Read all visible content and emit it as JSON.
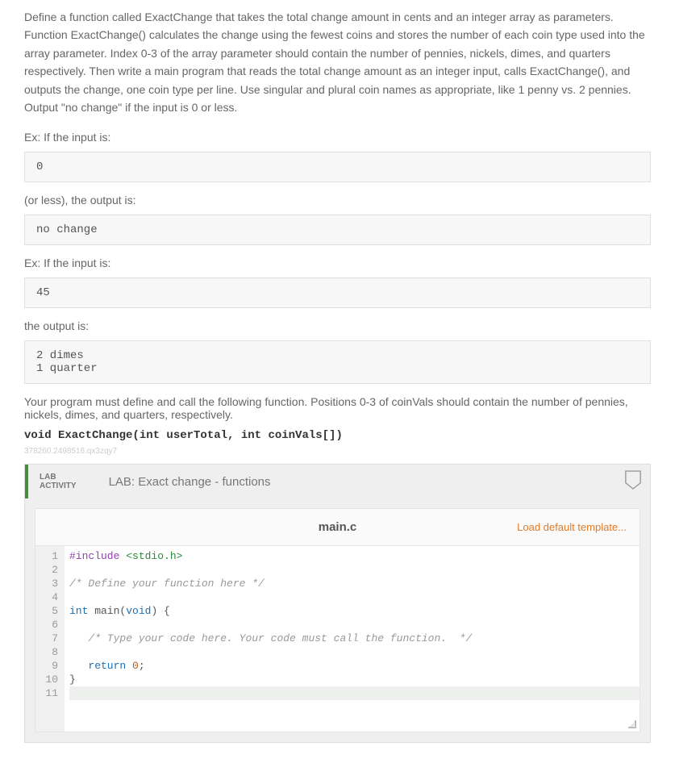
{
  "description": "Define a function called ExactChange that takes the total change amount in cents and an integer array as parameters. Function ExactChange() calculates the change using the fewest coins and stores the number of each coin type used into the array parameter. Index 0-3 of the array parameter should contain the number of pennies, nickels, dimes, and quarters respectively. Then write a main program that reads the total change amount as an integer input, calls ExactChange(), and outputs the change, one coin type per line. Use singular and plural coin names as appropriate, like 1 penny vs. 2 pennies. Output \"no change\" if the input is 0 or less.",
  "example1_label": "Ex: If the input is:",
  "example1_input": "0",
  "example1_or_less": "(or less), the output is:",
  "example1_output": "no change",
  "example2_label": "Ex: If the input is:",
  "example2_input": "45",
  "example2_output_label": "the output is:",
  "example2_output": "2 dimes\n1 quarter",
  "must_define": "Your program must define and call the following function. Positions 0-3 of coinVals should contain the number of pennies, nickels, dimes, and quarters, respectively.",
  "func_signature": "void ExactChange(int userTotal, int coinVals[])",
  "watermark": "378260.2498516.qx3zqy7",
  "lab": {
    "badge_line1": "LAB",
    "badge_line2": "ACTIVITY",
    "title": "LAB: Exact change - functions"
  },
  "editor": {
    "filename": "main.c",
    "load_template": "Load default template...",
    "lines": [
      {
        "n": 1,
        "tokens": [
          [
            "preproc",
            "#include "
          ],
          [
            "string",
            "<stdio.h>"
          ]
        ]
      },
      {
        "n": 2,
        "tokens": []
      },
      {
        "n": 3,
        "tokens": [
          [
            "comment",
            "/* Define your function here */"
          ]
        ]
      },
      {
        "n": 4,
        "tokens": []
      },
      {
        "n": 5,
        "tokens": [
          [
            "type",
            "int"
          ],
          [
            "plain",
            " main("
          ],
          [
            "type",
            "void"
          ],
          [
            "plain",
            ") {"
          ]
        ]
      },
      {
        "n": 6,
        "tokens": []
      },
      {
        "n": 7,
        "tokens": [
          [
            "plain",
            "   "
          ],
          [
            "comment",
            "/* Type your code here. Your code must call the function.  */"
          ]
        ]
      },
      {
        "n": 8,
        "tokens": []
      },
      {
        "n": 9,
        "tokens": [
          [
            "plain",
            "   "
          ],
          [
            "type",
            "return"
          ],
          [
            "plain",
            " "
          ],
          [
            "num",
            "0"
          ],
          [
            "plain",
            ";"
          ]
        ]
      },
      {
        "n": 10,
        "tokens": [
          [
            "plain",
            "}"
          ]
        ]
      },
      {
        "n": 11,
        "tokens": [],
        "cursor": true
      }
    ]
  }
}
